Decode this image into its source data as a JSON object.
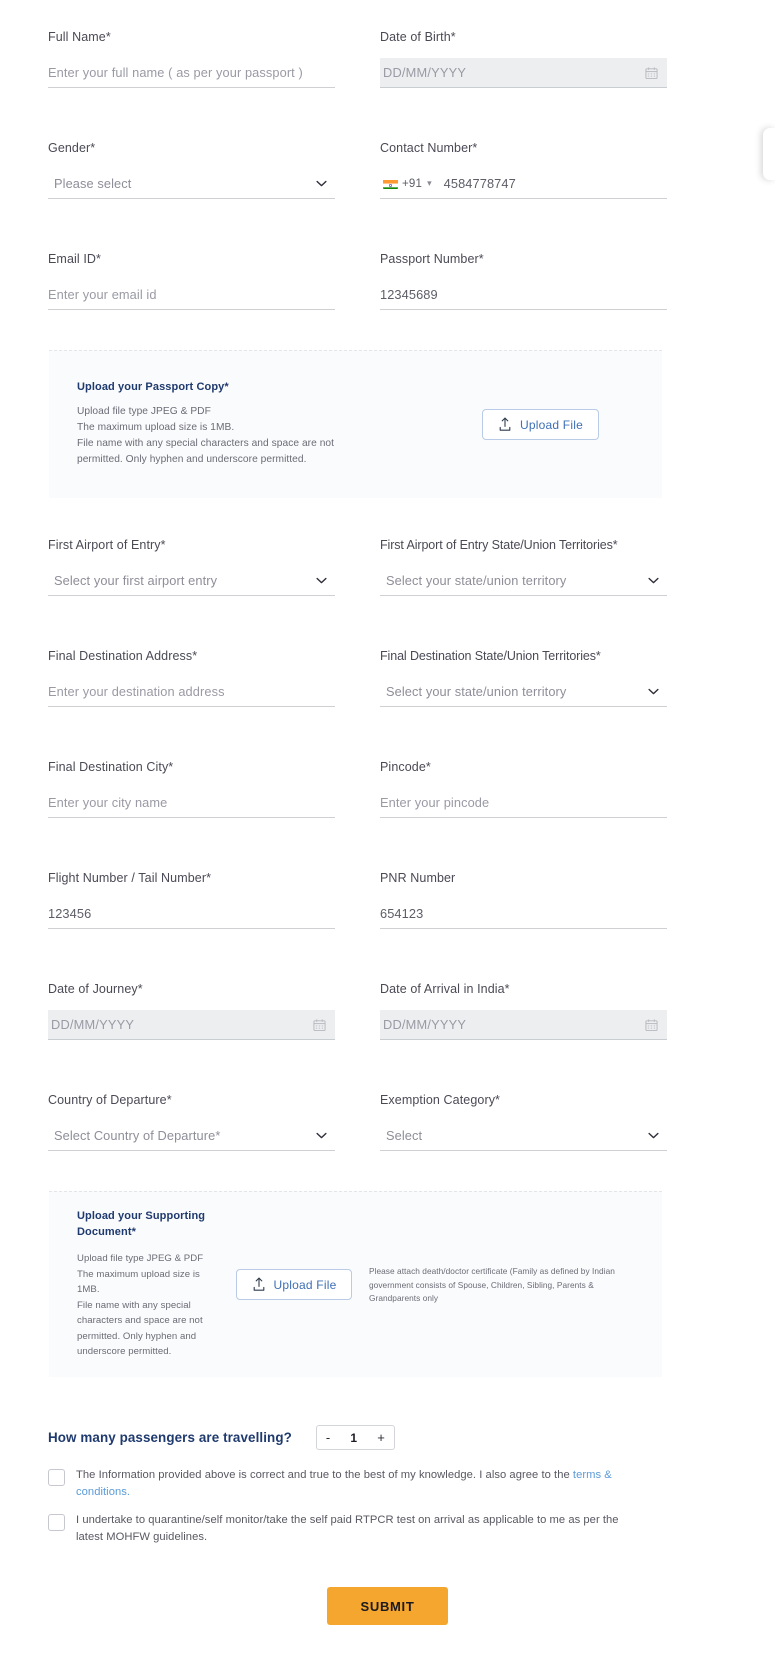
{
  "form": {
    "fields": {
      "full_name": {
        "label": "Full Name*",
        "placeholder": "Enter your full name ( as per your passport )",
        "value": ""
      },
      "dob": {
        "label": "Date of Birth*",
        "placeholder": "DD/MM/YYYY",
        "value": "",
        "icon": "calendar-icon"
      },
      "gender": {
        "label": "Gender*",
        "selected": "Please select",
        "icon": "chevron-down-icon"
      },
      "contact_number": {
        "label": "Contact Number*",
        "country_code": "+91",
        "flag": "india-flag-icon",
        "value": "4584778747"
      },
      "email": {
        "label": "Email ID*",
        "placeholder": "Enter your email id",
        "value": ""
      },
      "passport_number": {
        "label": "Passport Number*",
        "value": "12345689"
      },
      "first_airport": {
        "label": "First Airport of Entry*",
        "selected": "Select your first airport entry",
        "icon": "chevron-down-icon"
      },
      "first_airport_state": {
        "label": "First Airport of Entry State/Union Territories*",
        "selected": "Select your state/union territory",
        "icon": "chevron-down-icon"
      },
      "final_address": {
        "label": "Final Destination Address*",
        "placeholder": "Enter your destination address",
        "value": ""
      },
      "final_state": {
        "label": "Final Destination State/Union Territories*",
        "selected": "Select your state/union territory",
        "icon": "chevron-down-icon"
      },
      "final_city": {
        "label": "Final Destination City*",
        "placeholder": "Enter your city name",
        "value": ""
      },
      "pincode": {
        "label": "Pincode*",
        "placeholder": "Enter your pincode",
        "value": ""
      },
      "flight_number": {
        "label": "Flight Number / Tail Number*",
        "value": "123456"
      },
      "pnr_number": {
        "label": "PNR Number",
        "value": "654123"
      },
      "date_of_journey": {
        "label": "Date of Journey*",
        "placeholder": "DD/MM/YYYY",
        "value": "",
        "icon": "calendar-icon"
      },
      "date_of_arrival": {
        "label": "Date of Arrival in India*",
        "placeholder": "DD/MM/YYYY",
        "value": "",
        "icon": "calendar-icon"
      },
      "country_departure": {
        "label": "Country of Departure*",
        "selected": "Select Country of Departure*",
        "icon": "chevron-down-icon"
      },
      "exemption_category": {
        "label": "Exemption Category*",
        "selected": "Select",
        "icon": "chevron-down-icon"
      }
    },
    "upload_passport": {
      "title": "Upload your Passport Copy*",
      "line1": "Upload file type JPEG & PDF",
      "line2": "The maximum upload size is 1MB.",
      "line3": "File name with any special characters and space are not",
      "line4": "permitted. Only hyphen and underscore permitted.",
      "button_label": "Upload File",
      "button_icon": "upload-icon"
    },
    "upload_supporting": {
      "title": "Upload your Supporting Document*",
      "line1": "Upload file type JPEG & PDF",
      "line2": "The maximum upload size is",
      "line3": "1MB.",
      "line4": "File name with any special",
      "line5": "characters and space are not",
      "line6": "permitted. Only hyphen and",
      "line7": "underscore permitted.",
      "button_label": "Upload File",
      "button_icon": "upload-icon",
      "note": "Please attach death/doctor certificate (Family as defined by Indian government consists of Spouse, Children, Sibling, Parents & Grandparents only"
    },
    "passengers": {
      "question": "How many passengers are travelling?",
      "decrement": "-",
      "count": "1",
      "increment": "+"
    },
    "consents": [
      {
        "text_before": "The Information provided above is correct and true to the best of my knowledge. I also agree to the ",
        "link": "terms & conditions.",
        "text_after": ""
      },
      {
        "text_before": "I undertake to quarantine/self monitor/take the self paid RTPCR test on arrival as applicable to me as per the latest MOHFW guidelines.",
        "link": "",
        "text_after": ""
      }
    ],
    "submit_label": "SUBMIT",
    "colors": {
      "submit_bg": "#F5A62E",
      "heading_blue": "#1F3A6E",
      "link_blue": "#5A9BD8",
      "upload_btn_text": "#3F6FB5"
    }
  }
}
